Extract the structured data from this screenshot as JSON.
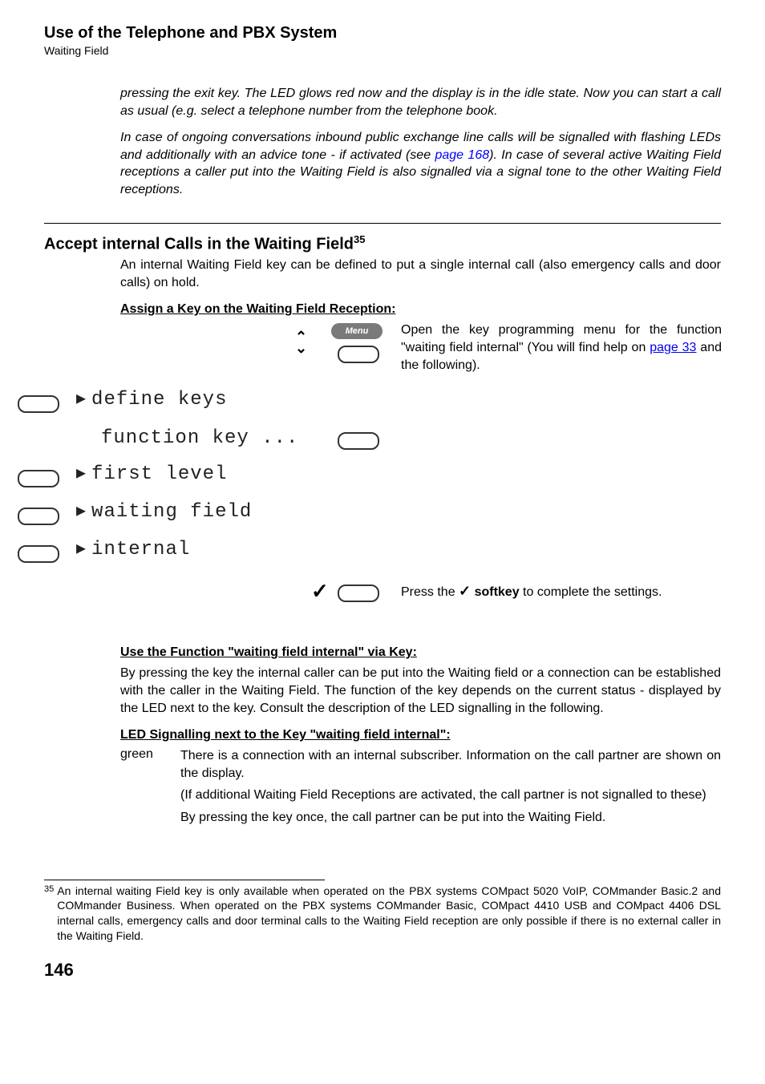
{
  "header": {
    "title": "Use of the Telephone and PBX System",
    "subtitle": "Waiting Field"
  },
  "intro": {
    "p1_a": "pressing the exit key. The LED glows red now and the display is in the idle state. Now you can start a call as usual (e.g. select a telephone number from the telephone book.",
    "p2_before": "In case of ongoing conversations inbound public exchange line calls will be signalled with flashing LEDs and additionally with an advice tone - if activated (see ",
    "p2_link": "page 168",
    "p2_after": "). In case of several active Waiting Field receptions a caller put into the Waiting Field is also signalled via a signal tone to the other Waiting Field receptions."
  },
  "section": {
    "heading": "Accept internal Calls in the Waiting Field",
    "sup": "35",
    "lead": "An internal Waiting Field key can be defined to put a single internal call (also emergency calls and door calls) on hold.",
    "assign_heading": "Assign a Key on the Waiting Field Reception:"
  },
  "diagram": {
    "menu_label": "Menu",
    "right_before": "Open the key programming menu for the function \"waiting field internal\" (You will find help on ",
    "right_link": "page 33",
    "right_after": " and the following).",
    "lcd1": "define keys",
    "lcd2": "function key ...",
    "lcd3": "first level",
    "lcd4": "waiting field",
    "lcd5": "internal",
    "press_before": "Press the ",
    "press_tick": "✓",
    "press_bold": " softkey",
    "press_after": " to complete the settings."
  },
  "usefunc": {
    "heading": "Use the Function \"waiting field internal\" via Key:",
    "body": "By pressing the key the internal caller can be put into the Waiting field or a connection can be established with the caller in the Waiting Field. The function of the key depends on the current status - displayed by the LED next to the key. Consult the description of the LED signalling in the following."
  },
  "led": {
    "heading": "LED Signalling next to the Key \"waiting field internal\":",
    "label": "green",
    "p1": "There is a connection with an internal subscriber. Information on the call partner are shown on the display.",
    "p2": "(If additional Waiting Field Receptions are activated, the call partner is not signalled to these)",
    "p3": "By pressing the key once, the call partner can be put into the Waiting Field."
  },
  "footnote": {
    "num": "35",
    "text": "An internal waiting Field key is only available when operated on the PBX systems COMpact 5020 VoIP, COMmander Basic.2 and COMmander Business. When operated on the PBX systems COMmander Basic, COMpact 4410 USB and COMpact 4406 DSL internal calls, emergency calls and door terminal calls to the Waiting Field reception are only possible if there is no external caller in the Waiting Field."
  },
  "page_number": "146"
}
